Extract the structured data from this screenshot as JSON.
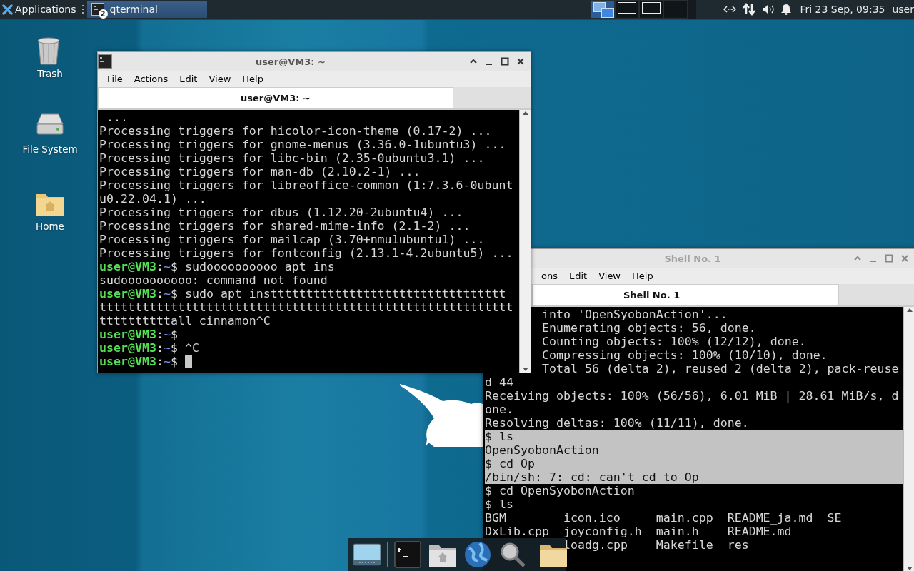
{
  "panel": {
    "menu_button": "Applications",
    "tasks": [
      {
        "label": "qterminal",
        "badge": "2",
        "selected": true
      }
    ],
    "workspaces": [
      {
        "selected": true,
        "has_window": true
      },
      {
        "selected": false,
        "has_window": true
      },
      {
        "selected": false,
        "has_window": true
      },
      {
        "selected": false,
        "has_window": false
      }
    ],
    "clock": "Fri 23 Sep, 09:35",
    "user": "user"
  },
  "desktop_icons": [
    {
      "label": "Trash",
      "kind": "trash"
    },
    {
      "label": "File System",
      "kind": "drive"
    },
    {
      "label": "Home",
      "kind": "home"
    }
  ],
  "windows": [
    {
      "title": "user@VM3: ~",
      "active": true,
      "menu": [
        "File",
        "Actions",
        "Edit",
        "View",
        "Help"
      ],
      "tabs": [
        {
          "label": "user@VM3: ~",
          "selected": true
        }
      ],
      "rows": [
        {
          "kind": "output",
          "text": " ..."
        },
        {
          "kind": "output",
          "text": "Processing triggers for hicolor-icon-theme (0.17-2) ..."
        },
        {
          "kind": "output",
          "text": "Processing triggers for gnome-menus (3.36.0-1ubuntu3) ..."
        },
        {
          "kind": "output",
          "text": "Processing triggers for libc-bin (2.35-0ubuntu3.1) ..."
        },
        {
          "kind": "output",
          "text": "Processing triggers for man-db (2.10.2-1) ..."
        },
        {
          "kind": "output",
          "text": "Processing triggers for libreoffice-common (1:7.3.6-0ubunt"
        },
        {
          "kind": "output",
          "text": "u0.22.04.1) ..."
        },
        {
          "kind": "output",
          "text": "Processing triggers for dbus (1.12.20-2ubuntu4) ..."
        },
        {
          "kind": "output",
          "text": "Processing triggers for shared-mime-info (2.1-2) ..."
        },
        {
          "kind": "output",
          "text": "Processing triggers for mailcap (3.70+nmu1ubuntu1) ..."
        },
        {
          "kind": "output",
          "text": "Processing triggers for fontconfig (2.13.1-4.2ubuntu5) ..."
        },
        {
          "kind": "prompt",
          "user": "user@VM3",
          "sep": ":",
          "path": "~",
          "mark": "$",
          "command": "sudoooooooooo apt ins",
          "cursor": false
        },
        {
          "kind": "output",
          "text": "sudoooooooooo: command not found"
        },
        {
          "kind": "prompt",
          "user": "user@VM3",
          "sep": ":",
          "path": "~",
          "mark": "$",
          "command": "sudo apt insttttttttttttttttttttttttttttttttt",
          "cursor": false
        },
        {
          "kind": "output",
          "text": "tttttttttttttttttttttttttttttttttttttttttttttttttttttttttt"
        },
        {
          "kind": "output",
          "text": "ttttttttttall cinnamon^C"
        },
        {
          "kind": "prompt",
          "user": "user@VM3",
          "sep": ":",
          "path": "~",
          "mark": "$",
          "cursor": false
        },
        {
          "kind": "prompt",
          "user": "user@VM3",
          "sep": ":",
          "path": "~",
          "mark": "$",
          "command": "^C",
          "cursor": false
        },
        {
          "kind": "prompt",
          "user": "user@VM3",
          "sep": ":",
          "path": "~",
          "mark": "$",
          "cursor": true
        }
      ]
    },
    {
      "title": "Shell No. 1",
      "active": false,
      "menu": [
        "ons",
        "Edit",
        "View",
        "Help"
      ],
      "tabs": [
        {
          "label": "Shell No. 1",
          "selected": true
        }
      ],
      "rows": [
        {
          "kind": "cut",
          "text": "into 'OpenSyobonAction'...",
          "selected": false
        },
        {
          "kind": "cut",
          "text": "Enumerating objects: 56, done.",
          "selected": false
        },
        {
          "kind": "cut",
          "text": "Counting objects: 100% (12/12), done.",
          "selected": false
        },
        {
          "kind": "cut",
          "text": "Compressing objects: 100% (10/10), done.",
          "selected": false
        },
        {
          "kind": "cut",
          "text": "Total 56 (delta 2), reused 2 (delta 2), pack-reuse",
          "selected": false
        },
        {
          "kind": "output",
          "text": "d 44",
          "selected": false
        },
        {
          "kind": "output",
          "text": "Receiving objects: 100% (56/56), 6.01 MiB | 28.61 MiB/s, d",
          "selected": false
        },
        {
          "kind": "output",
          "text": "one.",
          "selected": false
        },
        {
          "kind": "output",
          "text": "Resolving deltas: 100% (11/11), done.",
          "selected": false
        },
        {
          "kind": "output",
          "text": "$ ls",
          "selected": true
        },
        {
          "kind": "output",
          "text": "OpenSyobonAction",
          "selected": true
        },
        {
          "kind": "output",
          "text": "$ cd Op",
          "selected": true
        },
        {
          "kind": "output",
          "text": "/bin/sh: 7: cd: can't cd to Op",
          "selected": true
        },
        {
          "kind": "output",
          "text": "$ cd OpenSyobonAction",
          "selected": false
        },
        {
          "kind": "output",
          "text": "$ ls",
          "selected": false
        },
        {
          "kind": "output",
          "text": "BGM        icon.ico     main.cpp  README_ja.md  SE",
          "selected": false
        },
        {
          "kind": "output",
          "text": "DxLib.cpp  joyconfig.h  main.h    README.md",
          "selected": false
        },
        {
          "kind": "after-dock",
          "text": "loadg.cpp    Makefile  res",
          "selected": false
        }
      ]
    }
  ],
  "dock": [
    {
      "kind": "desktop"
    },
    {
      "kind": "separator"
    },
    {
      "kind": "terminal"
    },
    {
      "kind": "home"
    },
    {
      "kind": "globe"
    },
    {
      "kind": "search"
    },
    {
      "kind": "separator"
    },
    {
      "kind": "folder"
    }
  ]
}
